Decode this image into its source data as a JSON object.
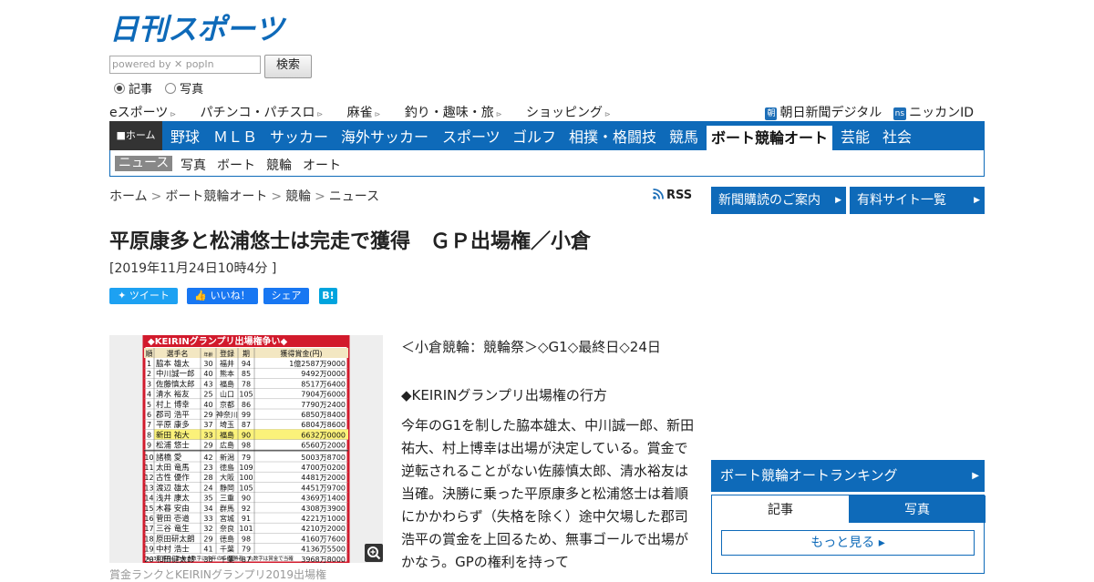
{
  "brand": {
    "logo_text": "日刊スポーツ"
  },
  "search": {
    "placeholder": "powered by ✕ popIn",
    "button": "検索",
    "radio1": "記事",
    "radio2": "写真"
  },
  "subnav": {
    "items": [
      "eスポーツ",
      "パチンコ・パチスロ",
      "麻雀",
      "釣り・趣味・旅",
      "ショッピング"
    ],
    "right": [
      {
        "tag": "朝",
        "label": "朝日新聞デジタル"
      },
      {
        "tag": "ns",
        "label": "ニッカンID"
      }
    ]
  },
  "mainnav": {
    "home": "ホーム",
    "items": [
      "野球",
      "ＭＬＢ",
      "サッカー",
      "海外サッカー",
      "スポーツ",
      "ゴルフ",
      "相撲・格闘技",
      "競馬",
      "ボート競輪オート",
      "芸能",
      "社会"
    ]
  },
  "secnav": {
    "items": [
      "ニュース",
      "写真",
      "ボート",
      "競輪",
      "オート"
    ]
  },
  "breadcrumb": [
    "ホーム",
    "ボート競輪オート",
    "競輪",
    "ニュース"
  ],
  "rss": "RSS",
  "side": {
    "btn1": "新聞購読のご案内",
    "btn2": "有料サイト一覧"
  },
  "article": {
    "title": "平原康多と松浦悠士は完走で獲得　ＧＰ出場権／小倉",
    "date": "[2019年11月24日10時4分 ]",
    "share": {
      "tweet": "ツイート",
      "like": "いいね！",
      "fb_share": "シェア",
      "hatena": "B!"
    },
    "p1": "＜小倉競輪：競輪祭＞◇G1◇最終日◇24日",
    "p2": "◆KEIRINグランプリ出場権の行方",
    "p3": "今年のG1を制した脇本雄太、中川誠一郎、新田祐大、村上博幸は出場が決定している。賞金で逆転されることがない佐藤慎太郎、清水裕友は当確。決勝に乗った平原康多と松浦悠士は着順にかかわらず（失格を除く）途中欠場した郡司浩平の賞金を上回るため、無事ゴールで出場がかなう。GPの権利を持って",
    "caption": "賞金ランクとKEIRINグランプリ2019出場権"
  },
  "photo_table": {
    "title": "◆KEIRINグランプリ出場権争い◆",
    "headers": [
      "順",
      "選手名",
      "年齢",
      "登録",
      "期",
      "獲得賞金(円)"
    ],
    "rows": [
      [
        "1",
        "脇本 雄太",
        "30",
        "福井",
        "94",
        "1億2587万9000"
      ],
      [
        "2",
        "中川誠一郎",
        "40",
        "熊本",
        "85",
        "9492万0000"
      ],
      [
        "3",
        "佐藤慎太郎",
        "43",
        "福島",
        "78",
        "8517万6400"
      ],
      [
        "4",
        "清水 裕友",
        "25",
        "山口",
        "105",
        "7904万6000"
      ],
      [
        "5",
        "村上 博幸",
        "40",
        "京都",
        "86",
        "7790万2400"
      ],
      [
        "6",
        "郡司 浩平",
        "29",
        "神奈川",
        "99",
        "6850万8400"
      ],
      [
        "7",
        "平原 康多",
        "37",
        "埼玉",
        "87",
        "6804万8600"
      ],
      [
        "8",
        "新田 祐大",
        "33",
        "福島",
        "90",
        "6632万0000"
      ],
      [
        "9",
        "松浦 悠士",
        "29",
        "広島",
        "98",
        "6560万2000"
      ],
      [
        "10",
        "諸橋 愛",
        "42",
        "新潟",
        "79",
        "5003万8700"
      ],
      [
        "11",
        "太田 竜馬",
        "23",
        "徳島",
        "109",
        "4700万0200"
      ],
      [
        "12",
        "古性 優作",
        "28",
        "大阪",
        "100",
        "4481万2000"
      ],
      [
        "13",
        "渡辺 雄太",
        "24",
        "静岡",
        "105",
        "4451万9700"
      ],
      [
        "14",
        "浅井 康太",
        "35",
        "三重",
        "90",
        "4369万1400"
      ],
      [
        "15",
        "木暮 安由",
        "34",
        "群馬",
        "92",
        "4308万3900"
      ],
      [
        "16",
        "菅田 壱道",
        "33",
        "宮城",
        "91",
        "4221万1000"
      ],
      [
        "17",
        "三谷 竜生",
        "32",
        "奈良",
        "101",
        "4210万2000"
      ],
      [
        "18",
        "原田研太朗",
        "29",
        "徳島",
        "98",
        "4160万7600"
      ],
      [
        "19",
        "中村 浩士",
        "41",
        "千葉",
        "79",
        "4136万5500"
      ],
      [
        "20",
        "和田健太郎",
        "38",
        "千葉",
        "87",
        "3968万8000"
      ]
    ],
    "footnote": "※23日現在。白抜き数字は今年のＧⅠ優勝者。丸数字は賞金で当確"
  },
  "ranking": {
    "title": "ボート競輪オートランキング",
    "tab1": "記事",
    "tab2": "写真",
    "more": "もっと見る"
  },
  "colors": {
    "brand_blue": "#0e6ab9",
    "twitter": "#1da1f2",
    "facebook": "#1877f2",
    "hatena": "#00a4de"
  }
}
